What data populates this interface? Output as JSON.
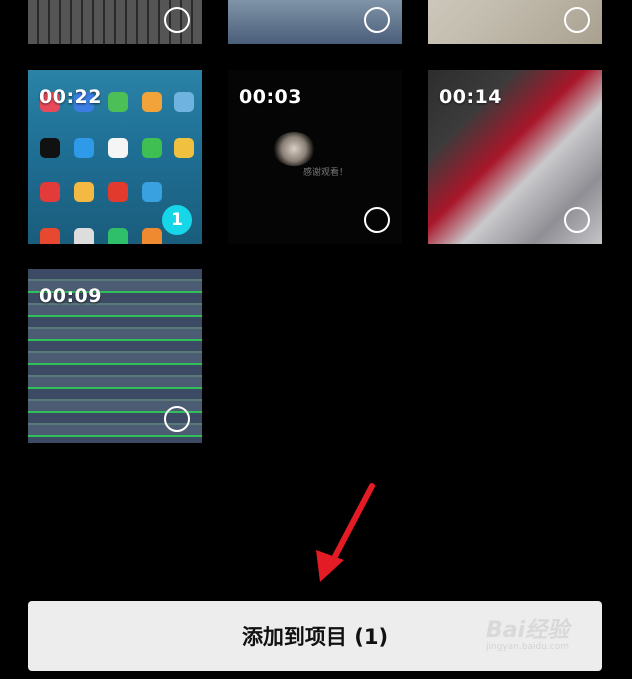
{
  "grid": {
    "tiles": [
      {
        "id": "keyboard",
        "duration": "",
        "selected": false
      },
      {
        "id": "people",
        "duration": "",
        "selected": false
      },
      {
        "id": "rice",
        "duration": "",
        "selected": false
      },
      {
        "id": "phone-home",
        "duration": "00:22",
        "selected": true,
        "selection_index": "1"
      },
      {
        "id": "dark",
        "duration": "00:03",
        "selected": false,
        "caption": "感谢观看！"
      },
      {
        "id": "motion-blur",
        "duration": "00:14",
        "selected": false
      },
      {
        "id": "stadium",
        "duration": "00:09",
        "selected": false
      }
    ]
  },
  "footer": {
    "add_to_project_label": "添加到项目 (1)"
  },
  "watermark": {
    "brand": "Bai经验",
    "url": "jingyan.baidu.com"
  },
  "colors": {
    "selected_badge": "#16d6e8",
    "annotation_arrow": "#e21b24",
    "add_button_bg": "#ededed"
  }
}
